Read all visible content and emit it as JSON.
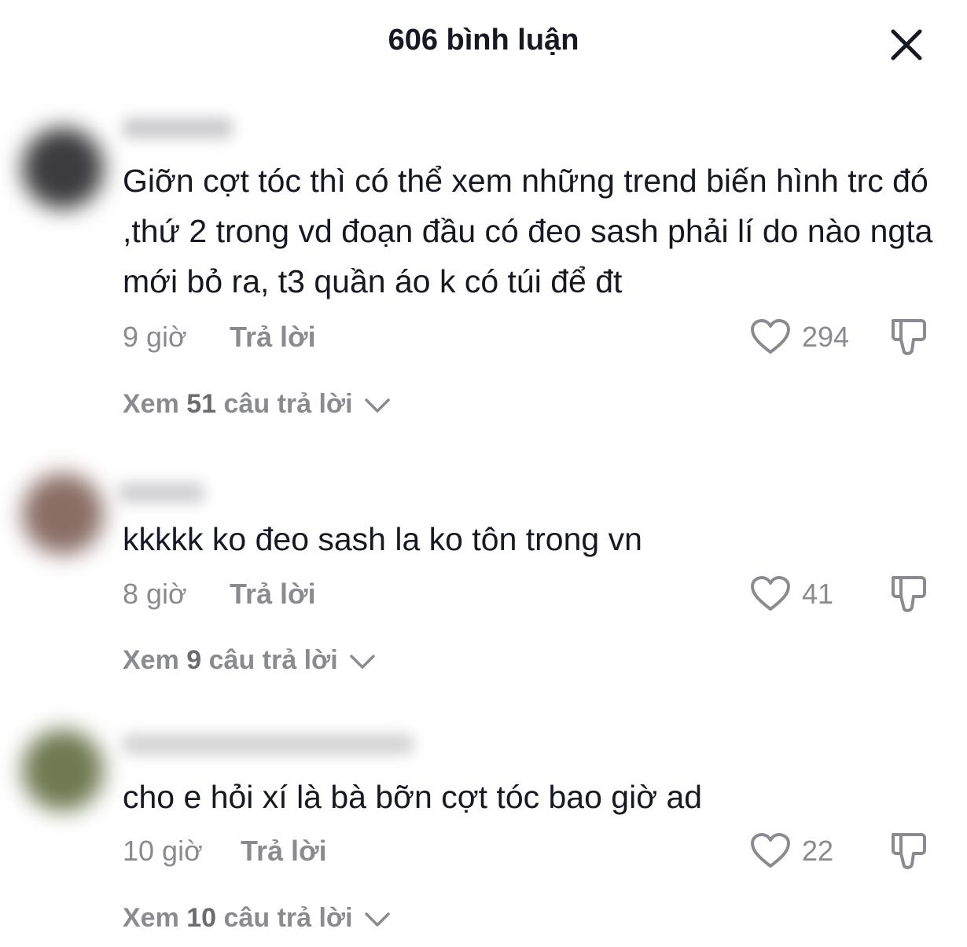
{
  "header": {
    "title": "606 bình luận",
    "close_icon": "close-icon"
  },
  "comments": [
    {
      "text": "Giỡn cợt tóc thì có thể xem những trend biến hình trc đó ,thứ 2 trong vd đoạn đầu có đeo sash phải lí do nào ngta mới bỏ ra, t3 quần áo k có túi để đt",
      "time": "9 giờ",
      "reply_label": "Trả lời",
      "likes": "294",
      "view_prefix": "Xem ",
      "view_count": "51",
      "view_suffix": " câu trả lời",
      "avatar_color": "#3c3c3e"
    },
    {
      "text": "kkkkk ko đeo sash la ko tôn trong vn",
      "time": "8 giờ",
      "reply_label": "Trả lời",
      "likes": "41",
      "view_prefix": "Xem ",
      "view_count": "9",
      "view_suffix": " câu trả lời",
      "avatar_color": "#8a6e66"
    },
    {
      "text": "cho e hỏi xí là bà bỡn cợt tóc bao giờ ad",
      "time": "10 giờ",
      "reply_label": "Trả lời",
      "likes": "22",
      "view_prefix": "Xem ",
      "view_count": "10",
      "view_suffix": " câu trả lời",
      "avatar_color": "#6f7a52"
    }
  ],
  "icons": {
    "like": "heart-outline-icon",
    "dislike": "thumbs-down-icon",
    "chevron": "chevron-down-icon"
  },
  "colors": {
    "text": "#161823",
    "secondary": "#8a8b91",
    "background": "#ffffff"
  }
}
